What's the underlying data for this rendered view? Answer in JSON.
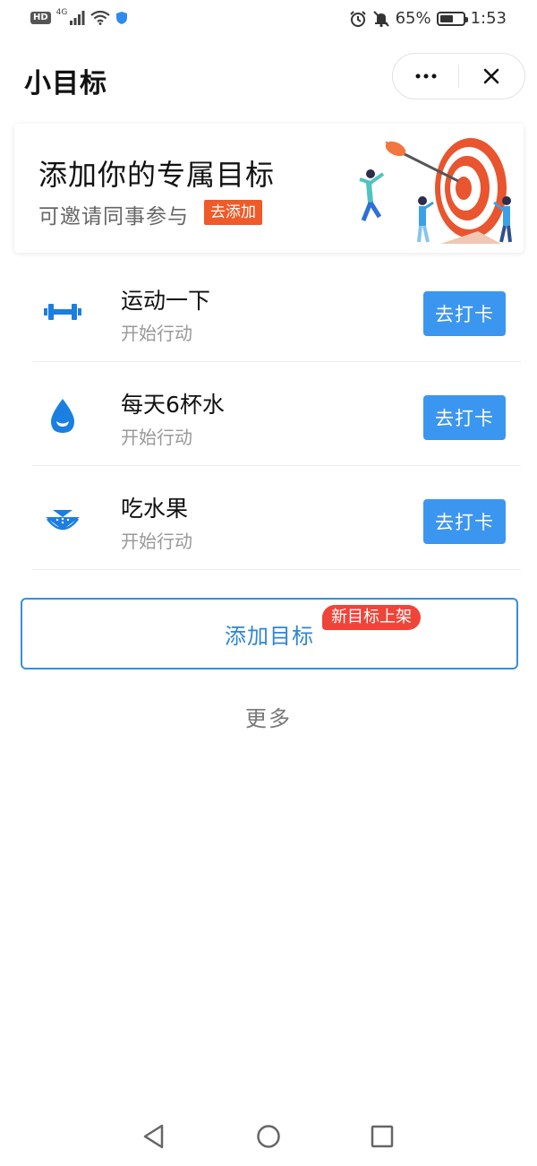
{
  "status_bar": {
    "hd": "HD",
    "signal": "4G",
    "battery": "65%",
    "battery_level": 0.65,
    "time": "1:53"
  },
  "header": {
    "title": "小目标"
  },
  "banner": {
    "title": "添加你的专属目标",
    "subtitle": "可邀请同事参与",
    "add_label": "去添加"
  },
  "goals": [
    {
      "name": "运动一下",
      "status": "开始行动",
      "button": "去打卡",
      "icon": "dumbbell-icon"
    },
    {
      "name": "每天6杯水",
      "status": "开始行动",
      "button": "去打卡",
      "icon": "water-drop-icon"
    },
    {
      "name": "吃水果",
      "status": "开始行动",
      "button": "去打卡",
      "icon": "watermelon-icon"
    }
  ],
  "add_goal": {
    "label": "添加目标",
    "badge": "新目标上架"
  },
  "more_label": "更多",
  "colors": {
    "accent_blue": "#3b96f0",
    "outline_blue": "#3a8ed6",
    "badge_red": "#f04438",
    "banner_orange": "#f05a28"
  }
}
